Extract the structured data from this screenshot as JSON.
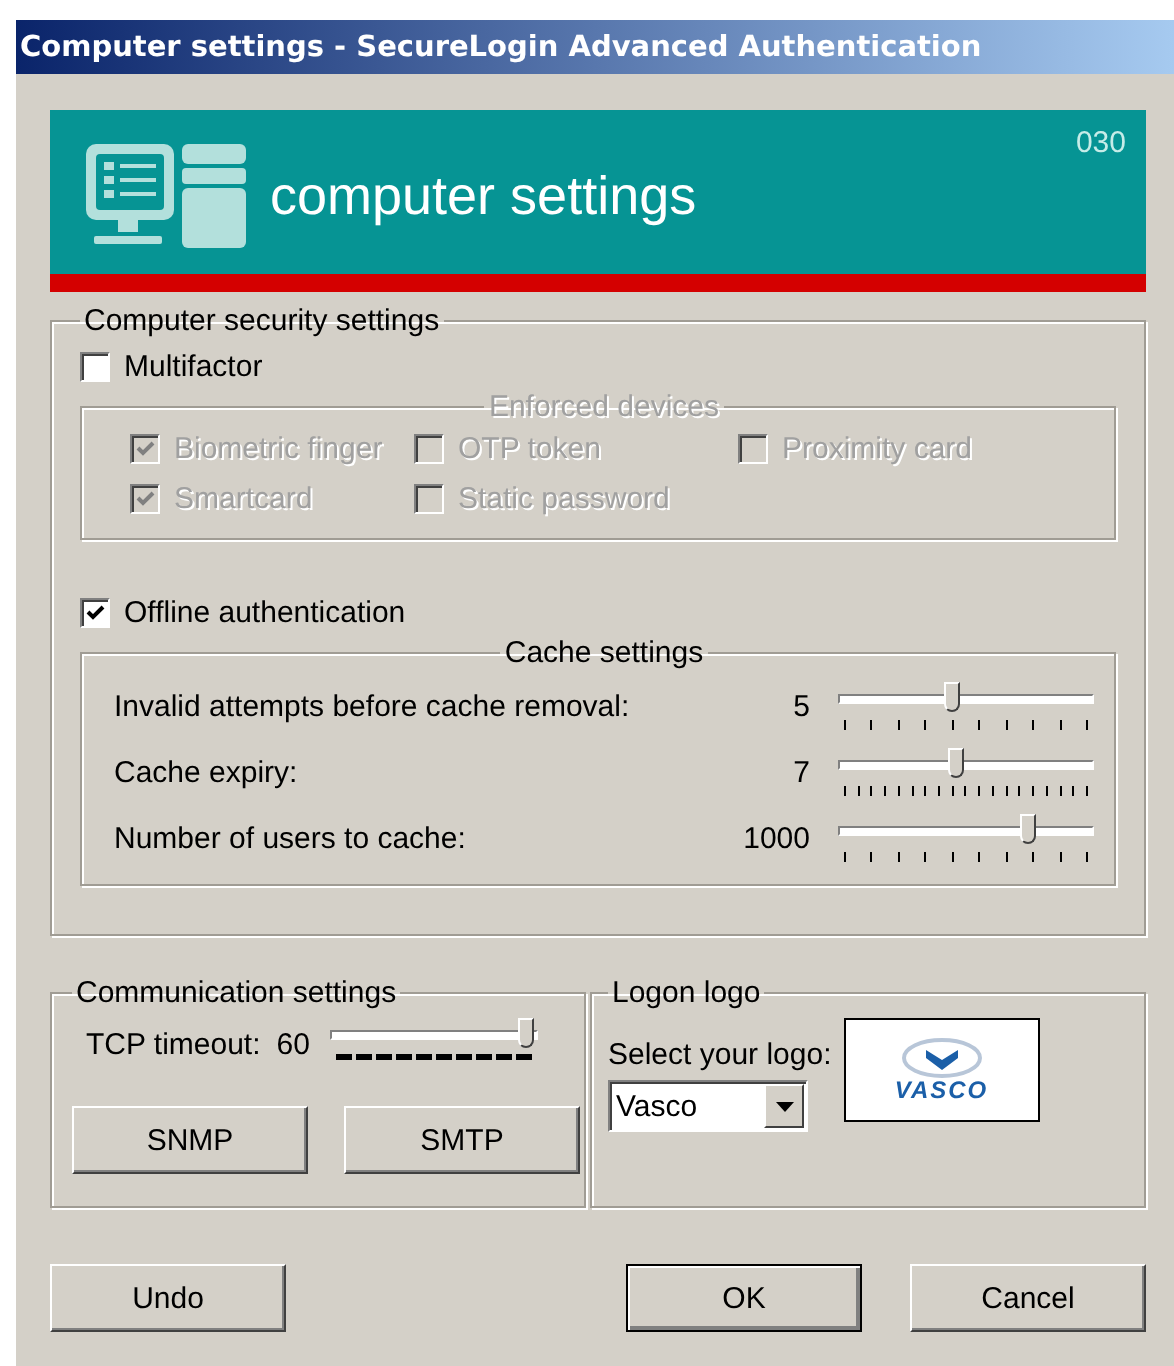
{
  "window": {
    "title": "Computer settings - SecureLogin Advanced Authentication"
  },
  "banner": {
    "title": "computer settings",
    "code": "030"
  },
  "security": {
    "title": "Computer security settings",
    "multifactor": {
      "label": "Multifactor",
      "checked": false
    },
    "enforced_devices": {
      "title": "Enforced devices",
      "disabled": true,
      "items": [
        {
          "label": "Biometric finger",
          "checked": true
        },
        {
          "label": "OTP token",
          "checked": false
        },
        {
          "label": "Proximity card",
          "checked": false
        },
        {
          "label": "Smartcard",
          "checked": true
        },
        {
          "label": "Static password",
          "checked": false
        }
      ]
    },
    "offline": {
      "label": "Offline authentication",
      "checked": true
    },
    "cache": {
      "title": "Cache settings",
      "rows": [
        {
          "label": "Invalid attempts before cache removal:",
          "value": "5",
          "level": 0.45
        },
        {
          "label": "Cache expiry:",
          "value": "7",
          "level": 0.47
        },
        {
          "label": "Number of users to cache:",
          "value": "1000",
          "level": 0.77
        }
      ]
    }
  },
  "communication": {
    "title": "Communication settings",
    "tcp_label": "TCP timeout:",
    "tcp_value": "60",
    "level": 1.0,
    "buttons": [
      "SNMP",
      "SMTP"
    ]
  },
  "logon_logo": {
    "title": "Logon logo",
    "select_label": "Select your logo:",
    "selected_logo": "Vasco",
    "logo_text": "VASCO"
  },
  "buttons": [
    {
      "label": "Undo",
      "default": false
    },
    {
      "label": "OK",
      "default": true
    },
    {
      "label": "Cancel",
      "default": false
    }
  ]
}
